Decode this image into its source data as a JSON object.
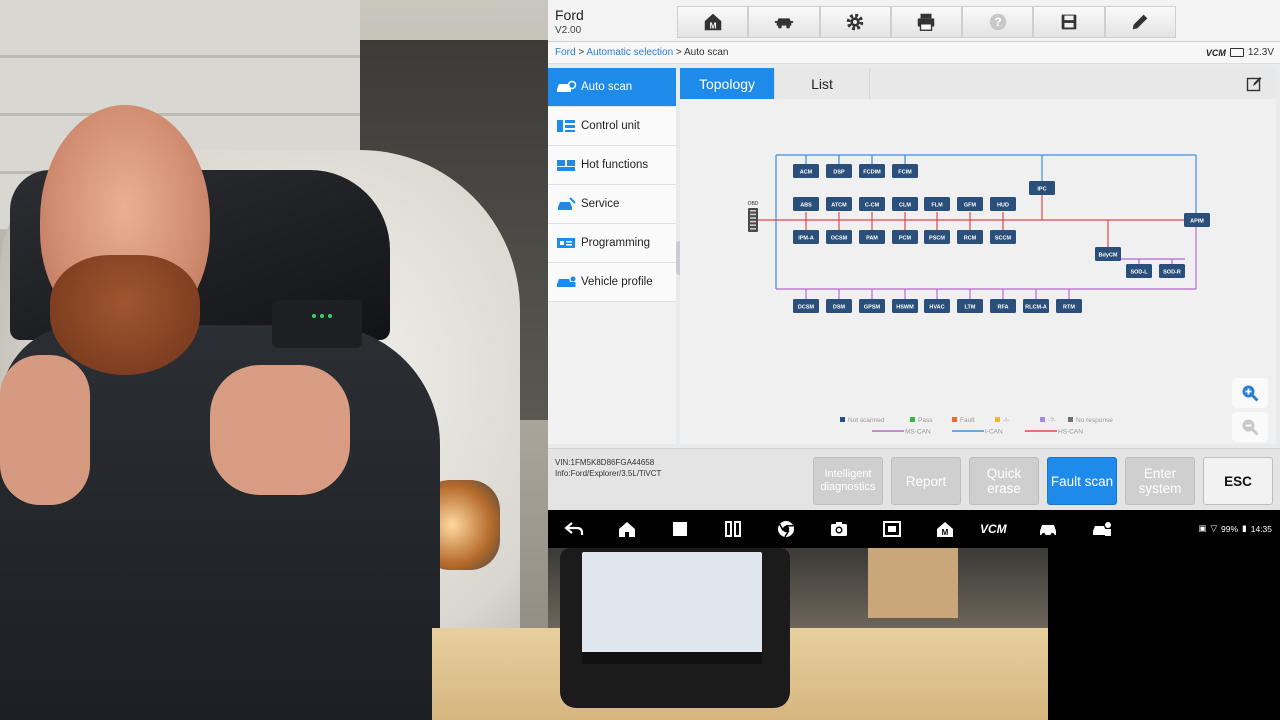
{
  "app": {
    "title": "Ford",
    "version": "V2.00",
    "breadcrumb": {
      "link1": "Ford",
      "sep1": " > ",
      "link2": "Automatic selection",
      "sep2": " > ",
      "current": "Auto scan"
    },
    "vcm_label": "VCM",
    "voltage": "12.3V",
    "toolbar_icons": [
      "home-icon",
      "car-lift-icon",
      "gear-icon",
      "printer-icon",
      "help-icon",
      "save-icon",
      "pencil-icon"
    ]
  },
  "sidebar": {
    "items": [
      {
        "label": "Auto scan",
        "icon": "car-scan-icon",
        "active": true
      },
      {
        "label": "Control unit",
        "icon": "control-unit-icon",
        "active": false
      },
      {
        "label": "Hot functions",
        "icon": "hot-functions-icon",
        "active": false
      },
      {
        "label": "Service",
        "icon": "service-icon",
        "active": false
      },
      {
        "label": "Programming",
        "icon": "programming-icon",
        "active": false
      },
      {
        "label": "Vehicle profile",
        "icon": "vehicle-profile-icon",
        "active": false
      }
    ]
  },
  "tabs": [
    {
      "label": "Topology",
      "active": true
    },
    {
      "label": "List",
      "active": false
    }
  ],
  "topology": {
    "obd_label": "OBD",
    "row1": [
      "ACM",
      "DSP",
      "FCDIM",
      "FCIM"
    ],
    "row2": [
      "ABS",
      "ATCM",
      "C-CM",
      "CLM",
      "FLM",
      "GFM",
      "HUD"
    ],
    "row3": [
      "IPM-A",
      "OCSM",
      "PAM",
      "PCM",
      "PSCM",
      "RCM",
      "SCCM"
    ],
    "bottom_row": [
      "DCSM",
      "DSM",
      "GPSM",
      "HSWM",
      "HVAC",
      "LTM",
      "RFA",
      "RLCM-A",
      "RTM"
    ],
    "ipc": "IPC",
    "apim": "APIM",
    "bdycm": "BdyCM",
    "sod_l": "SOD-L",
    "sod_r": "SOD-R",
    "legend": {
      "not_scanned": "Not scanned",
      "pass": "Pass",
      "fault": "Fault",
      "unknown1": "-!-",
      "unknown2": "-?-",
      "no_response": "No response",
      "ms_can": "MS-CAN",
      "i_can": "I-CAN",
      "hs_can": "HS-CAN"
    },
    "colors": {
      "module": "#2a4f7a",
      "ms_can": "#b36ad0",
      "i_can": "#3a8fe0",
      "hs_can": "#e0474c",
      "not_scanned": "#2a4f7a",
      "pass": "#3bb44a",
      "fault": "#ef6a2b",
      "unknown1": "#f0b432",
      "unknown2": "#a48be0",
      "no_response": "#707070"
    }
  },
  "footer": {
    "vin": "VIN:1FM5K8D86FGA44658",
    "info": "Info:Ford/Explorer/3.5L/TiVCT",
    "buttons": {
      "intelligent_diagnostics": "Intelligent diagnostics",
      "report": "Report",
      "quick_erase": "Quick erase",
      "fault_scan": "Fault scan",
      "enter_system": "Enter system",
      "esc": "ESC"
    }
  },
  "android_bar": {
    "battery": "99%",
    "time": "14:35",
    "vcm_label": "VCM"
  }
}
